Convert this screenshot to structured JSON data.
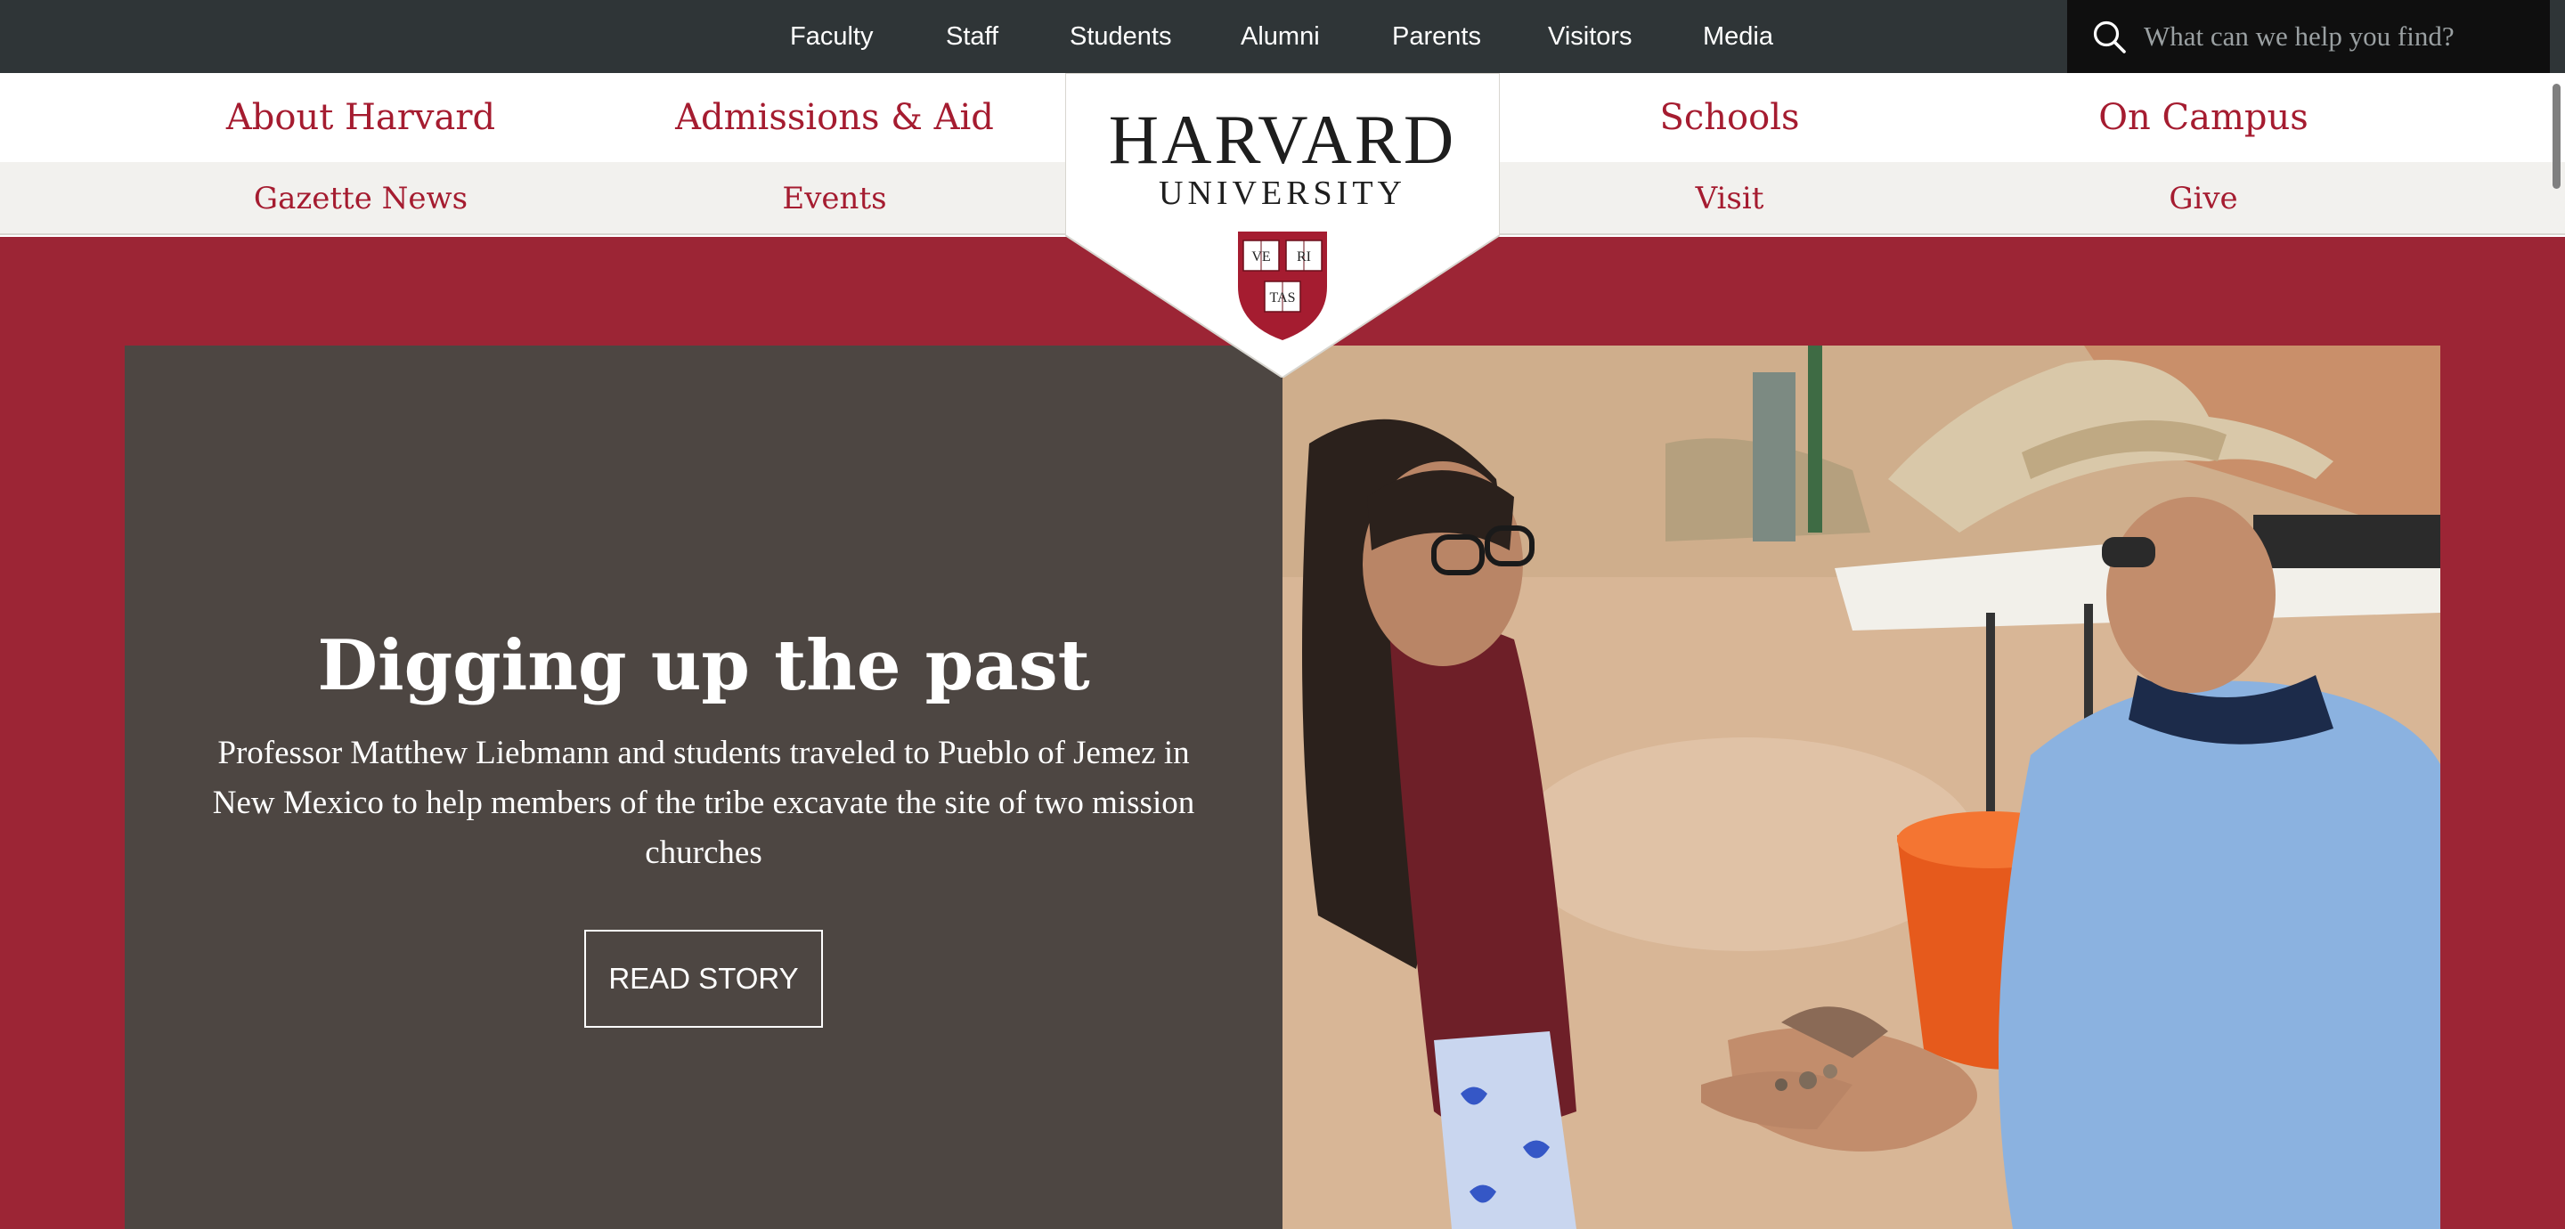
{
  "utility_nav": {
    "links": [
      "Faculty",
      "Staff",
      "Students",
      "Alumni",
      "Parents",
      "Visitors",
      "Media"
    ]
  },
  "search": {
    "placeholder": "What can we help you find?",
    "icon": "search-icon"
  },
  "primary_nav": {
    "links": [
      "About Harvard",
      "Admissions & Aid",
      "Schools",
      "On Campus"
    ]
  },
  "secondary_nav": {
    "links": [
      "Gazette News",
      "Events",
      "Visit",
      "Give"
    ]
  },
  "logo": {
    "title": "HARVARD",
    "subtitle": "UNIVERSITY",
    "crest_text": [
      "VE",
      "RI",
      "TAS"
    ]
  },
  "hero": {
    "title": "Digging up the past",
    "description": "Professor Matthew Liebmann and students traveled to Pueblo of Jemez in New Mexico to help members of the tribe excavate the site of two mission churches",
    "button_label": "READ STORY"
  },
  "colors": {
    "crimson": "#a51c30",
    "stage": "#9c2535",
    "top_bar": "#2f3537",
    "hero_panel": "#4d4642"
  }
}
